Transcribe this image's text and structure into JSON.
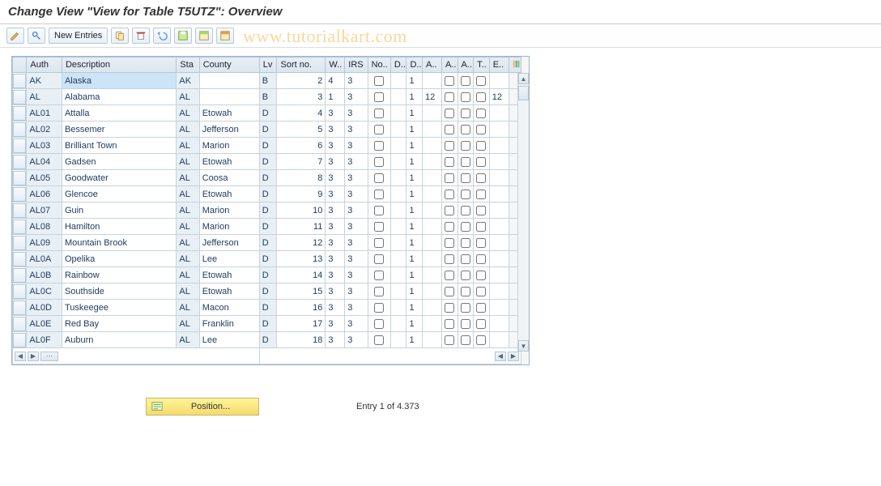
{
  "title": "Change View \"View for Table T5UTZ\": Overview",
  "watermark": "www.tutorialkart.com",
  "toolbar": {
    "new_entries": "New Entries"
  },
  "columns": [
    "Auth",
    "Description",
    "Sta",
    "County",
    "Lv",
    "Sort no.",
    "W..",
    "IRS",
    "No..",
    "D..",
    "D..",
    "A..",
    "A..",
    "A..",
    "T..",
    "E.."
  ],
  "rows": [
    {
      "auth": "AK",
      "desc": "Alaska",
      "sta": "AK",
      "county": "",
      "lv": "B",
      "sort": "2",
      "w": "4",
      "irs": "3",
      "no": false,
      "d1": "",
      "d2": "1",
      "a1": "",
      "a2": false,
      "a3": false,
      "t": false,
      "e": "",
      "hi": true
    },
    {
      "auth": "AL",
      "desc": "Alabama",
      "sta": "AL",
      "county": "",
      "lv": "B",
      "sort": "3",
      "w": "1",
      "irs": "3",
      "no": false,
      "d1": "",
      "d2": "1",
      "a1": "12",
      "a2": false,
      "a3": false,
      "t": false,
      "e": "12"
    },
    {
      "auth": "AL01",
      "desc": "Attalla",
      "sta": "AL",
      "county": "Etowah",
      "lv": "D",
      "sort": "4",
      "w": "3",
      "irs": "3",
      "no": false,
      "d1": "",
      "d2": "1",
      "a1": "",
      "a2": false,
      "a3": false,
      "t": false,
      "e": ""
    },
    {
      "auth": "AL02",
      "desc": "Bessemer",
      "sta": "AL",
      "county": "Jefferson",
      "lv": "D",
      "sort": "5",
      "w": "3",
      "irs": "3",
      "no": false,
      "d1": "",
      "d2": "1",
      "a1": "",
      "a2": false,
      "a3": false,
      "t": false,
      "e": ""
    },
    {
      "auth": "AL03",
      "desc": "Brilliant Town",
      "sta": "AL",
      "county": "Marion",
      "lv": "D",
      "sort": "6",
      "w": "3",
      "irs": "3",
      "no": false,
      "d1": "",
      "d2": "1",
      "a1": "",
      "a2": false,
      "a3": false,
      "t": false,
      "e": ""
    },
    {
      "auth": "AL04",
      "desc": "Gadsen",
      "sta": "AL",
      "county": "Etowah",
      "lv": "D",
      "sort": "7",
      "w": "3",
      "irs": "3",
      "no": false,
      "d1": "",
      "d2": "1",
      "a1": "",
      "a2": false,
      "a3": false,
      "t": false,
      "e": ""
    },
    {
      "auth": "AL05",
      "desc": "Goodwater",
      "sta": "AL",
      "county": "Coosa",
      "lv": "D",
      "sort": "8",
      "w": "3",
      "irs": "3",
      "no": false,
      "d1": "",
      "d2": "1",
      "a1": "",
      "a2": false,
      "a3": false,
      "t": false,
      "e": ""
    },
    {
      "auth": "AL06",
      "desc": "Glencoe",
      "sta": "AL",
      "county": "Etowah",
      "lv": "D",
      "sort": "9",
      "w": "3",
      "irs": "3",
      "no": false,
      "d1": "",
      "d2": "1",
      "a1": "",
      "a2": false,
      "a3": false,
      "t": false,
      "e": ""
    },
    {
      "auth": "AL07",
      "desc": "Guin",
      "sta": "AL",
      "county": "Marion",
      "lv": "D",
      "sort": "10",
      "w": "3",
      "irs": "3",
      "no": false,
      "d1": "",
      "d2": "1",
      "a1": "",
      "a2": false,
      "a3": false,
      "t": false,
      "e": ""
    },
    {
      "auth": "AL08",
      "desc": "Hamilton",
      "sta": "AL",
      "county": "Marion",
      "lv": "D",
      "sort": "11",
      "w": "3",
      "irs": "3",
      "no": false,
      "d1": "",
      "d2": "1",
      "a1": "",
      "a2": false,
      "a3": false,
      "t": false,
      "e": ""
    },
    {
      "auth": "AL09",
      "desc": "Mountain Brook",
      "sta": "AL",
      "county": "Jefferson",
      "lv": "D",
      "sort": "12",
      "w": "3",
      "irs": "3",
      "no": false,
      "d1": "",
      "d2": "1",
      "a1": "",
      "a2": false,
      "a3": false,
      "t": false,
      "e": ""
    },
    {
      "auth": "AL0A",
      "desc": "Opelika",
      "sta": "AL",
      "county": "Lee",
      "lv": "D",
      "sort": "13",
      "w": "3",
      "irs": "3",
      "no": false,
      "d1": "",
      "d2": "1",
      "a1": "",
      "a2": false,
      "a3": false,
      "t": false,
      "e": ""
    },
    {
      "auth": "AL0B",
      "desc": "Rainbow",
      "sta": "AL",
      "county": "Etowah",
      "lv": "D",
      "sort": "14",
      "w": "3",
      "irs": "3",
      "no": false,
      "d1": "",
      "d2": "1",
      "a1": "",
      "a2": false,
      "a3": false,
      "t": false,
      "e": ""
    },
    {
      "auth": "AL0C",
      "desc": "Southside",
      "sta": "AL",
      "county": "Etowah",
      "lv": "D",
      "sort": "15",
      "w": "3",
      "irs": "3",
      "no": false,
      "d1": "",
      "d2": "1",
      "a1": "",
      "a2": false,
      "a3": false,
      "t": false,
      "e": ""
    },
    {
      "auth": "AL0D",
      "desc": "Tuskeegee",
      "sta": "AL",
      "county": "Macon",
      "lv": "D",
      "sort": "16",
      "w": "3",
      "irs": "3",
      "no": false,
      "d1": "",
      "d2": "1",
      "a1": "",
      "a2": false,
      "a3": false,
      "t": false,
      "e": ""
    },
    {
      "auth": "AL0E",
      "desc": "Red Bay",
      "sta": "AL",
      "county": "Franklin",
      "lv": "D",
      "sort": "17",
      "w": "3",
      "irs": "3",
      "no": false,
      "d1": "",
      "d2": "1",
      "a1": "",
      "a2": false,
      "a3": false,
      "t": false,
      "e": ""
    },
    {
      "auth": "AL0F",
      "desc": "Auburn",
      "sta": "AL",
      "county": "Lee",
      "lv": "D",
      "sort": "18",
      "w": "3",
      "irs": "3",
      "no": false,
      "d1": "",
      "d2": "1",
      "a1": "",
      "a2": false,
      "a3": false,
      "t": false,
      "e": ""
    }
  ],
  "footer": {
    "position_label": "Position...",
    "entry_count": "Entry 1 of 4.373"
  }
}
